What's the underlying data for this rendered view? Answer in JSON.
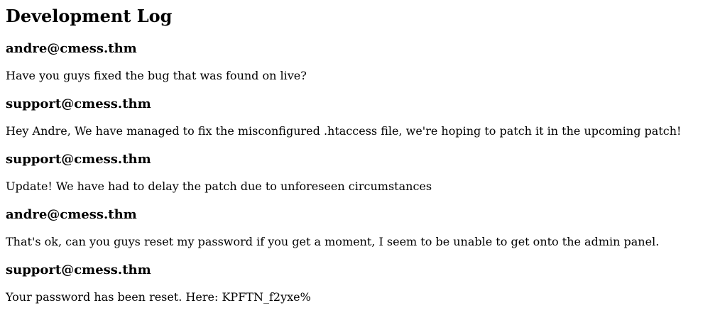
{
  "page": {
    "title": "Development Log"
  },
  "log": {
    "entries": [
      {
        "author": "andre@cmess.thm",
        "message": "Have you guys fixed the bug that was found on live?"
      },
      {
        "author": "support@cmess.thm",
        "message": "Hey Andre, We have managed to fix the misconfigured .htaccess file, we're hoping to patch it in the upcoming patch!"
      },
      {
        "author": "support@cmess.thm",
        "message": "Update! We have had to delay the patch due to unforeseen circumstances"
      },
      {
        "author": "andre@cmess.thm",
        "message": "That's ok, can you guys reset my password if you get a moment, I seem to be unable to get onto the admin panel."
      },
      {
        "author": "support@cmess.thm",
        "message": "Your password has been reset. Here: KPFTN_f2yxe%"
      }
    ]
  }
}
